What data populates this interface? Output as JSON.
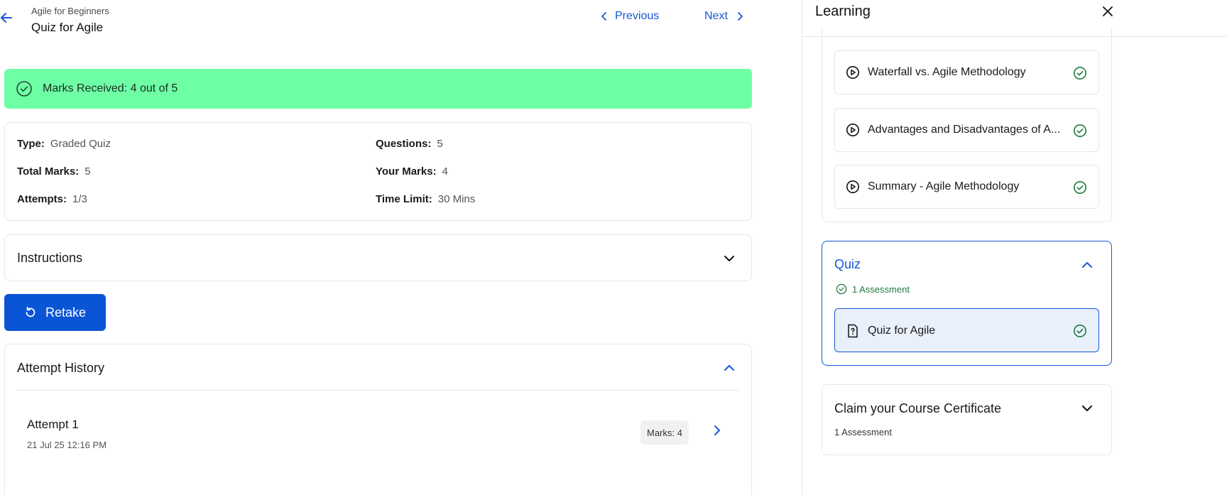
{
  "header": {
    "breadcrumb": "Agile for Beginners",
    "title": "Quiz for Agile",
    "previous_label": "Previous",
    "next_label": "Next"
  },
  "score_banner": {
    "text": "Marks Received: 4 out of 5",
    "color": "#6effa5"
  },
  "quiz_info": {
    "type_label": "Type:",
    "type_value": "Graded Quiz",
    "questions_label": "Questions:",
    "questions_value": "5",
    "total_marks_label": "Total Marks:",
    "total_marks_value": "5",
    "your_marks_label": "Your Marks:",
    "your_marks_value": "4",
    "attempts_label": "Attempts:",
    "attempts_value": "1/3",
    "time_limit_label": "Time Limit:",
    "time_limit_value": "30 Mins"
  },
  "instructions": {
    "title": "Instructions"
  },
  "retake": {
    "label": "Retake",
    "color": "#0a55d6"
  },
  "attempt_history": {
    "title": "Attempt History",
    "attempts": [
      {
        "title": "Attempt 1",
        "date": "21 Jul 25 12:16 PM",
        "marks": "Marks: 4"
      }
    ]
  },
  "panel": {
    "title": "Learning",
    "lessons": [
      {
        "label": "Waterfall vs. Agile Methodology",
        "icon": "play-circle-icon",
        "status": "completed"
      },
      {
        "label": "Advantages and Disadvantages of A...",
        "icon": "play-circle-icon",
        "status": "completed"
      },
      {
        "label": "Summary - Agile Methodology",
        "icon": "play-circle-icon",
        "status": "completed"
      }
    ],
    "quiz_section": {
      "title": "Quiz",
      "subtitle": "1 Assessment",
      "item": {
        "label": "Quiz for Agile",
        "icon": "quiz-document-icon",
        "status": "completed"
      }
    },
    "certificate_section": {
      "title": "Claim your Course Certificate",
      "subtitle": "1 Assessment"
    }
  },
  "colors": {
    "accent": "#1558d6",
    "success": "#1f7a3c"
  }
}
